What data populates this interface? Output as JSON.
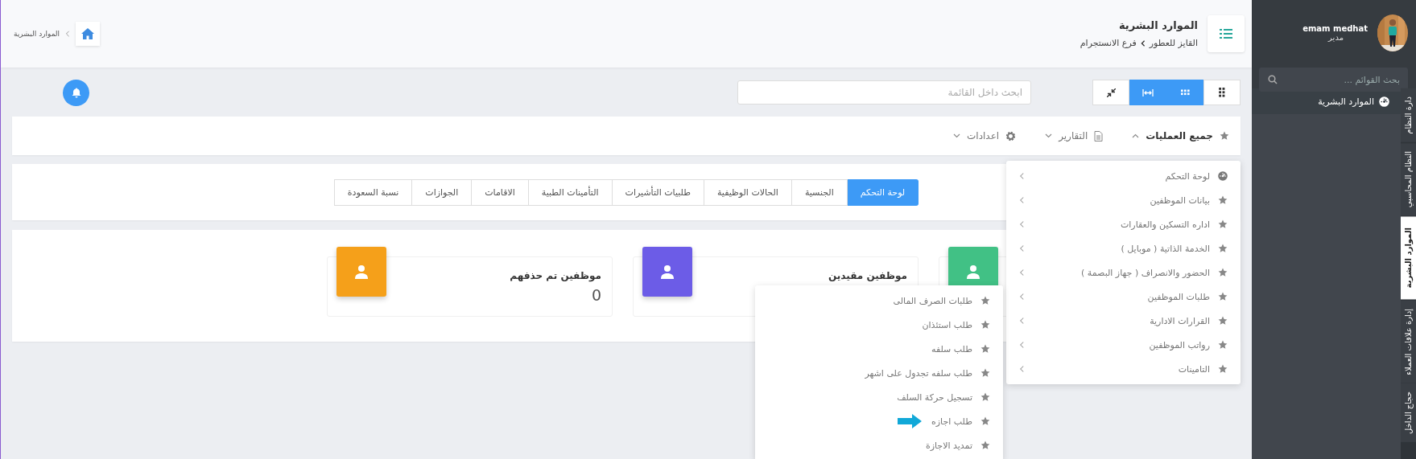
{
  "header": {
    "title": "الموارد البشرية",
    "breadcrumb": [
      "القايز للعطور",
      "فرع الانستجرام"
    ],
    "home_crumb": "الموارد البشرية"
  },
  "toolbar": {
    "view_buttons": [
      {
        "kind": "dots-small",
        "active": false
      },
      {
        "kind": "dots-grid",
        "active": true
      },
      {
        "kind": "expand",
        "active": true
      },
      {
        "kind": "compress",
        "active": false
      }
    ],
    "search": {
      "placeholder": "ابحث داخل القائمة"
    }
  },
  "menu_bar": [
    {
      "label": "جميع العمليات",
      "kind": "star",
      "expanded": true
    },
    {
      "label": "التقارير",
      "kind": "file",
      "expanded": false
    },
    {
      "label": "اعدادات",
      "kind": "gear",
      "expanded": false
    }
  ],
  "tabs": [
    {
      "label": "لوحة التحكم",
      "selected": true
    },
    {
      "label": "الجنسية",
      "selected": false
    },
    {
      "label": "الحالات الوظيفية",
      "selected": false
    },
    {
      "label": "طلبيات التأشيرات",
      "selected": false
    },
    {
      "label": "التأمينات الطبية",
      "selected": false
    },
    {
      "label": "الاقامات",
      "selected": false
    },
    {
      "label": "الجوازات",
      "selected": false
    },
    {
      "label": "نسبة السعودة",
      "selected": false
    }
  ],
  "stats": [
    {
      "color": "#41c185"
    },
    {
      "color": "#6c5ce7",
      "label": "موظفين مقيدين"
    },
    {
      "color": "#f5a01a",
      "label": "موظفين تم حذفهم",
      "value": "0"
    }
  ],
  "dropdowns": [
    {
      "items": [
        {
          "label": "لوحة التحكم",
          "kind": "gauge"
        },
        {
          "label": "بيانات الموظفين",
          "kind": "star"
        },
        {
          "label": "اداره التسكين والعقارات",
          "kind": "star"
        },
        {
          "label": "الخدمة الذاتية ( موبايل )",
          "kind": "star"
        },
        {
          "label": "الحضور والانصراف ( جهاز البصمة )",
          "kind": "star"
        },
        {
          "label": "طلبات الموظفين",
          "kind": "star"
        },
        {
          "label": "القرارات الادارية",
          "kind": "star"
        },
        {
          "label": "رواتب الموظفين",
          "kind": "star"
        },
        {
          "label": "التامينات",
          "kind": "star"
        }
      ]
    },
    {
      "items": [
        {
          "label": "طلبات الصرف المالى",
          "kind": "star",
          "pointed": false
        },
        {
          "label": "طلب استئذان",
          "kind": "star",
          "pointed": false
        },
        {
          "label": "طلب سلفه",
          "kind": "star",
          "pointed": false
        },
        {
          "label": "طلب سلفه تجدول على اشهر",
          "kind": "star",
          "pointed": false
        },
        {
          "label": "تسجيل حركة السلف",
          "kind": "star",
          "pointed": false
        },
        {
          "label": "طلب اجازه",
          "kind": "star",
          "pointed": true
        },
        {
          "label": "تمديد الاجازة",
          "kind": "star",
          "pointed": false
        }
      ]
    }
  ],
  "sidebar": {
    "user": {
      "name": "emam medhat",
      "role": "مدير"
    },
    "search": {
      "placeholder": "بحث القوائم ..."
    },
    "menu_items": [
      {
        "label": "الموارد البشرية"
      }
    ],
    "module_tabs": [
      {
        "label": "دارة النظام",
        "selected": false
      },
      {
        "label": "النظام المحاسبي",
        "selected": false
      },
      {
        "label": "الموارد البشرية",
        "selected": true
      },
      {
        "label": "إدارة علاقات العملاء",
        "selected": false
      },
      {
        "label": "حجاج الداخل",
        "selected": false
      }
    ]
  }
}
